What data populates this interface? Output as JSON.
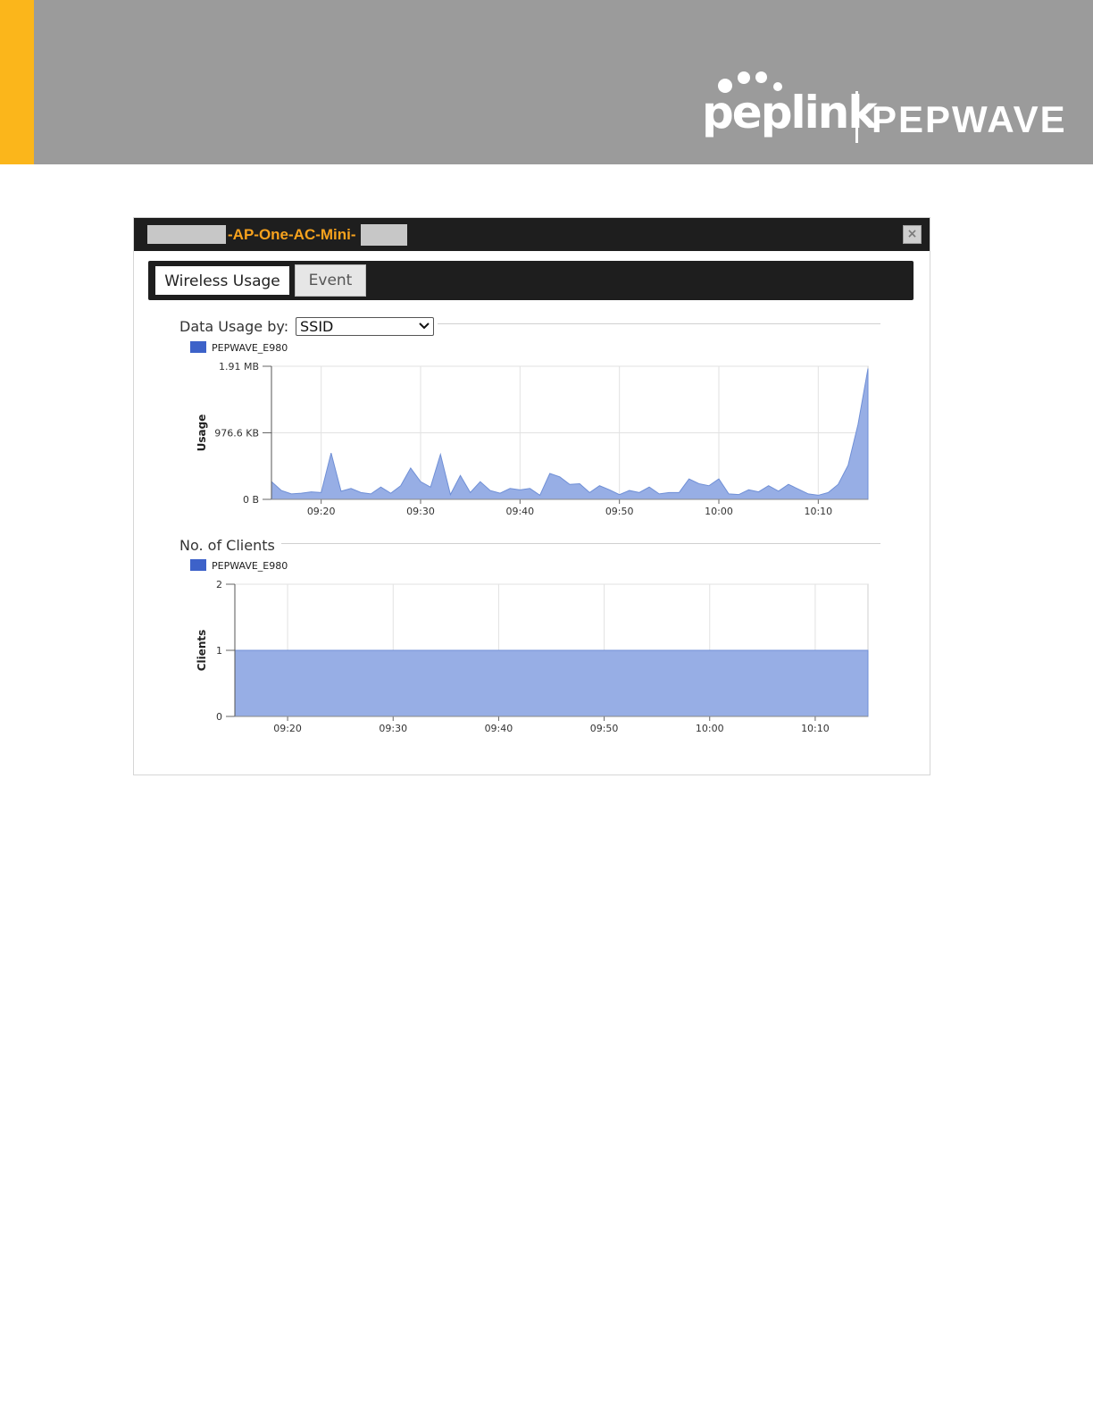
{
  "brand": {
    "logo_peplink": "peplink",
    "logo_pepwave": "PEPWAVE"
  },
  "dialog": {
    "title": "-AP-One-AC-Mini-",
    "close_glyph": "×"
  },
  "tabs": [
    {
      "label": "Wireless Usage",
      "active": true
    },
    {
      "label": "Event",
      "active": false
    }
  ],
  "usage_section": {
    "label": "Data Usage by:",
    "select_value": "SSID"
  },
  "clients_section": {
    "label": "No. of Clients"
  },
  "colors": {
    "series_fill": "#97aee5",
    "series_line": "#6f8fd6",
    "legend_swatch": "#3d62c9"
  },
  "chart_data": [
    {
      "type": "area",
      "ylabel": "Usage",
      "y_ticks": [
        {
          "label": "0 B",
          "value": 0
        },
        {
          "label": "976.6 KB",
          "value": 976.6
        },
        {
          "label": "1.91 MB",
          "value": 1953.1
        }
      ],
      "ylim": [
        0,
        1953.1
      ],
      "x_ticks": [
        "09:20",
        "09:30",
        "09:40",
        "09:50",
        "10:00",
        "10:10"
      ],
      "x_tick_minutes": [
        20,
        30,
        40,
        50,
        60,
        70
      ],
      "xlim_minutes": [
        15,
        75
      ],
      "legend": [
        "PEPWAVE_E980"
      ],
      "grid": true,
      "series": [
        {
          "name": "PEPWAVE_E980",
          "x_minutes": [
            15,
            16,
            17,
            18,
            19,
            20,
            21,
            22,
            23,
            24,
            25,
            26,
            27,
            28,
            29,
            30,
            31,
            32,
            33,
            34,
            35,
            36,
            37,
            38,
            39,
            40,
            41,
            42,
            43,
            44,
            45,
            46,
            47,
            48,
            49,
            50,
            51,
            52,
            53,
            54,
            55,
            56,
            57,
            58,
            59,
            60,
            61,
            62,
            63,
            64,
            65,
            66,
            67,
            68,
            69,
            70,
            71,
            72,
            73,
            74,
            75
          ],
          "values": [
            260,
            130,
            80,
            90,
            110,
            100,
            680,
            120,
            160,
            100,
            80,
            180,
            90,
            200,
            460,
            260,
            180,
            660,
            70,
            350,
            100,
            260,
            130,
            90,
            160,
            140,
            160,
            60,
            380,
            330,
            220,
            230,
            100,
            200,
            140,
            70,
            130,
            100,
            180,
            80,
            100,
            100,
            300,
            230,
            200,
            300,
            80,
            70,
            140,
            110,
            200,
            120,
            220,
            150,
            80,
            60,
            100,
            220,
            500,
            1100,
            1920
          ]
        }
      ]
    },
    {
      "type": "area",
      "ylabel": "Clients",
      "y_ticks": [
        {
          "label": "0",
          "value": 0
        },
        {
          "label": "1",
          "value": 1
        },
        {
          "label": "2",
          "value": 2
        }
      ],
      "ylim": [
        0,
        2
      ],
      "x_ticks": [
        "09:20",
        "09:30",
        "09:40",
        "09:50",
        "10:00",
        "10:10"
      ],
      "x_tick_minutes": [
        20,
        30,
        40,
        50,
        60,
        70
      ],
      "xlim_minutes": [
        15,
        75
      ],
      "legend": [
        "PEPWAVE_E980"
      ],
      "grid": true,
      "series": [
        {
          "name": "PEPWAVE_E980",
          "x_minutes": [
            15,
            75
          ],
          "values": [
            1,
            1
          ]
        }
      ]
    }
  ]
}
